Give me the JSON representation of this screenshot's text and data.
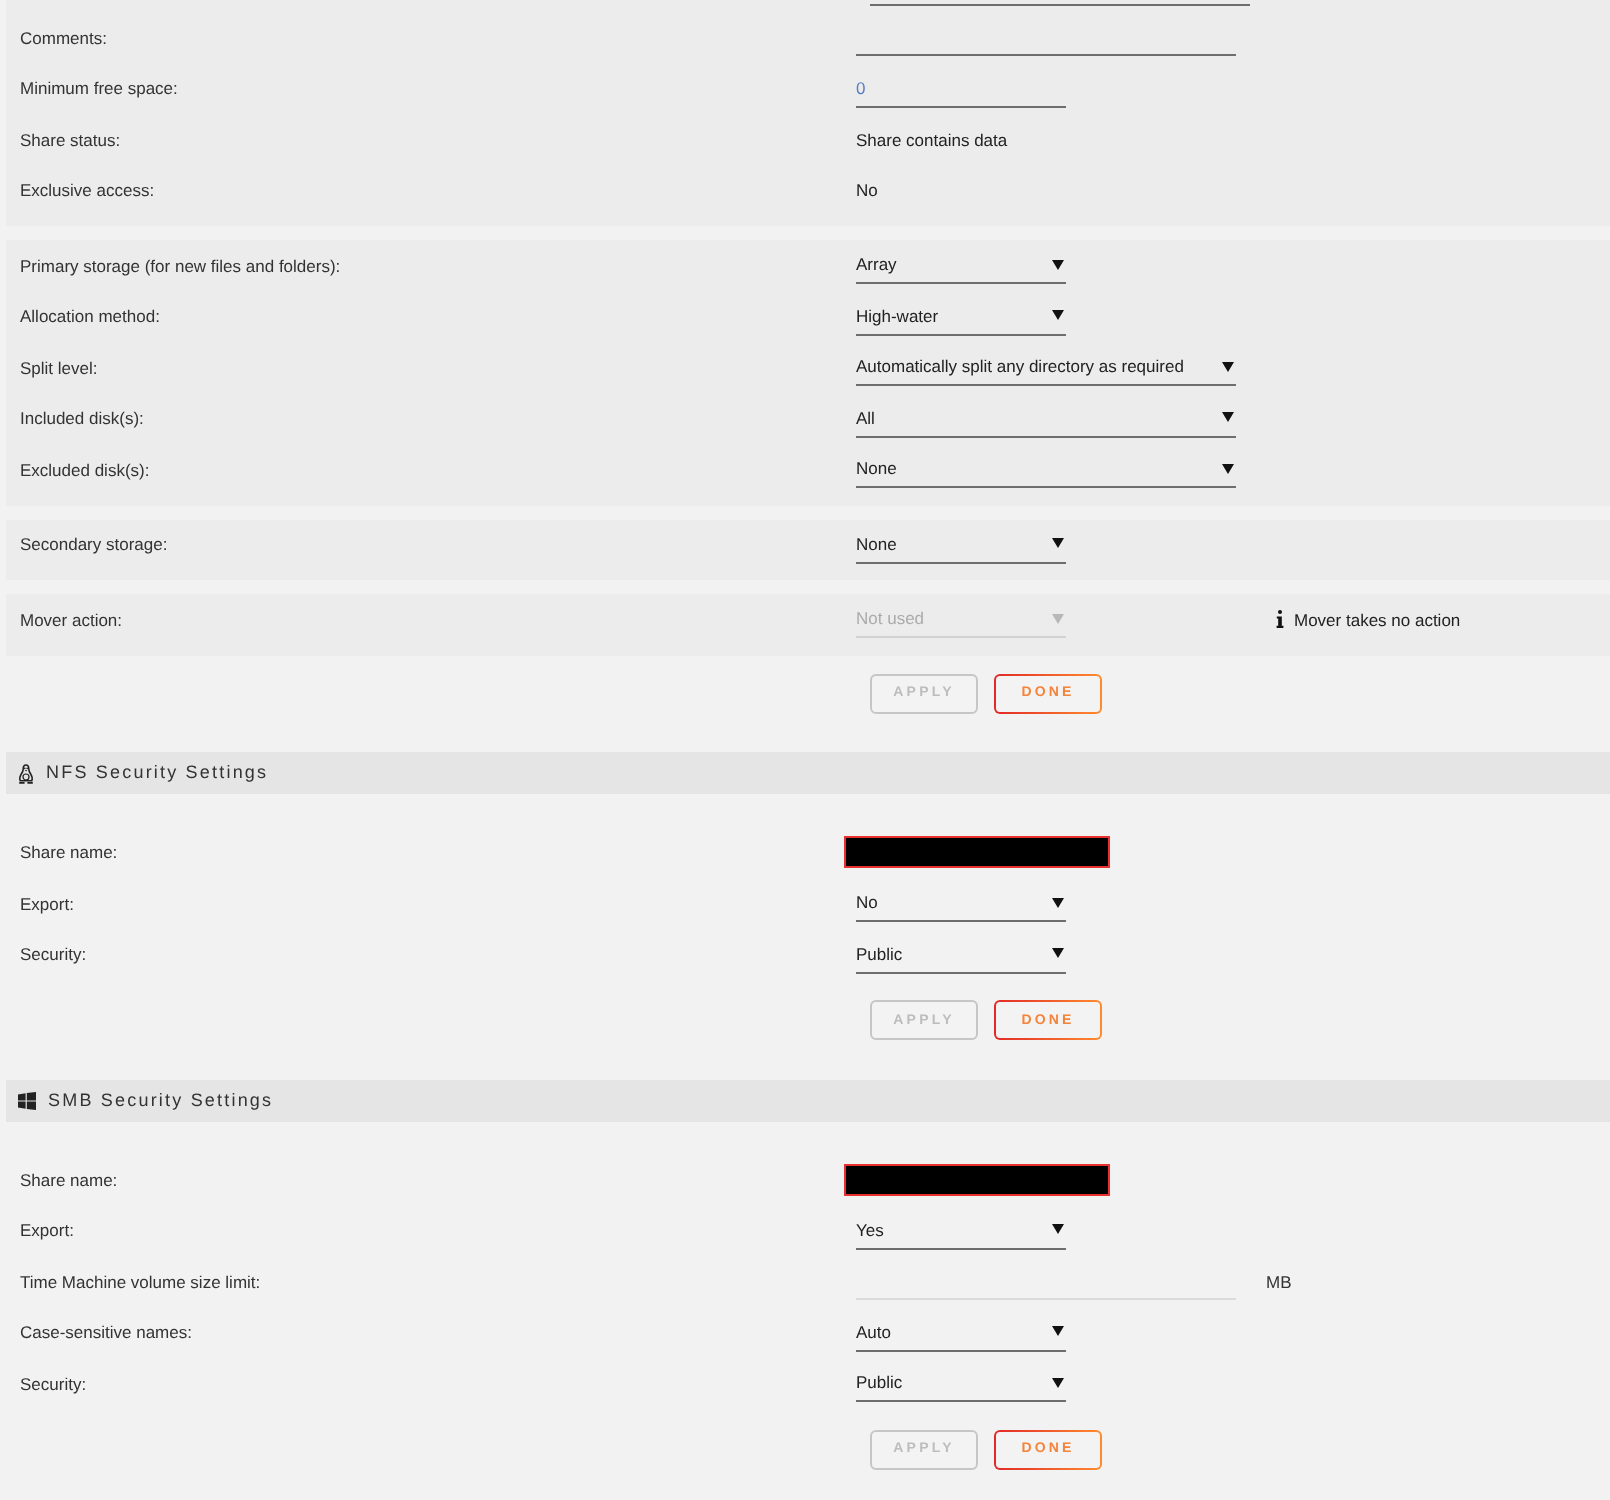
{
  "share_settings": {
    "panels": [
      {
        "cut_off_row": {
          "kind": "wideinput"
        },
        "rows": [
          {
            "label": "Comments:",
            "kind": "wideinput"
          },
          {
            "label": "Minimum free space:",
            "kind": "input",
            "value": "0"
          },
          {
            "label": "Share status:",
            "kind": "text",
            "value": "Share contains data"
          },
          {
            "label": "Exclusive access:",
            "kind": "text",
            "value": "No"
          }
        ]
      },
      {
        "rows": [
          {
            "label": "Primary storage (for new files and folders):",
            "kind": "select",
            "value": "Array"
          },
          {
            "label": "Allocation method:",
            "kind": "select",
            "value": "High-water"
          },
          {
            "label": "Split level:",
            "kind": "wideselect",
            "value": "Automatically split any directory as required"
          },
          {
            "label": "Included disk(s):",
            "kind": "wideselect",
            "value": "All"
          },
          {
            "label": "Excluded disk(s):",
            "kind": "wideselect",
            "value": "None"
          }
        ]
      },
      {
        "rows": [
          {
            "label": "Secondary storage:",
            "kind": "select",
            "value": "None"
          }
        ]
      },
      {
        "rows": [
          {
            "label": "Mover action:",
            "kind": "select",
            "value": "Not used",
            "disabled": true,
            "note": "Mover takes no action"
          }
        ]
      }
    ],
    "buttons": [
      {
        "label": "APPLY",
        "disabled": true
      },
      {
        "label": "DONE",
        "disabled": false
      }
    ]
  },
  "sections": [
    {
      "kind": "nfs",
      "title": "NFS Security Settings",
      "rows": [
        {
          "label": "Share name:",
          "kind": "redacted"
        },
        {
          "label": "Export:",
          "kind": "select",
          "value": "No"
        },
        {
          "label": "Security:",
          "kind": "select",
          "value": "Public"
        }
      ],
      "buttons": [
        {
          "label": "APPLY",
          "disabled": true
        },
        {
          "label": "DONE",
          "disabled": false
        }
      ]
    },
    {
      "kind": "smb",
      "title": "SMB Security Settings",
      "rows": [
        {
          "label": "Share name:",
          "kind": "redacted",
          "disabled": false
        },
        {
          "label": "Export:",
          "kind": "select",
          "value": "Yes",
          "disabled": false
        },
        {
          "label": "Time Machine volume size limit:",
          "kind": "wideinput",
          "disabled": true,
          "unit": "MB"
        },
        {
          "label": "Case-sensitive names:",
          "kind": "select",
          "value": "Auto",
          "disabled": false
        },
        {
          "label": "Security:",
          "kind": "select",
          "value": "Public",
          "disabled": false
        }
      ],
      "buttons": [
        {
          "label": "APPLY",
          "disabled": true
        },
        {
          "label": "DONE",
          "disabled": false
        }
      ]
    }
  ]
}
